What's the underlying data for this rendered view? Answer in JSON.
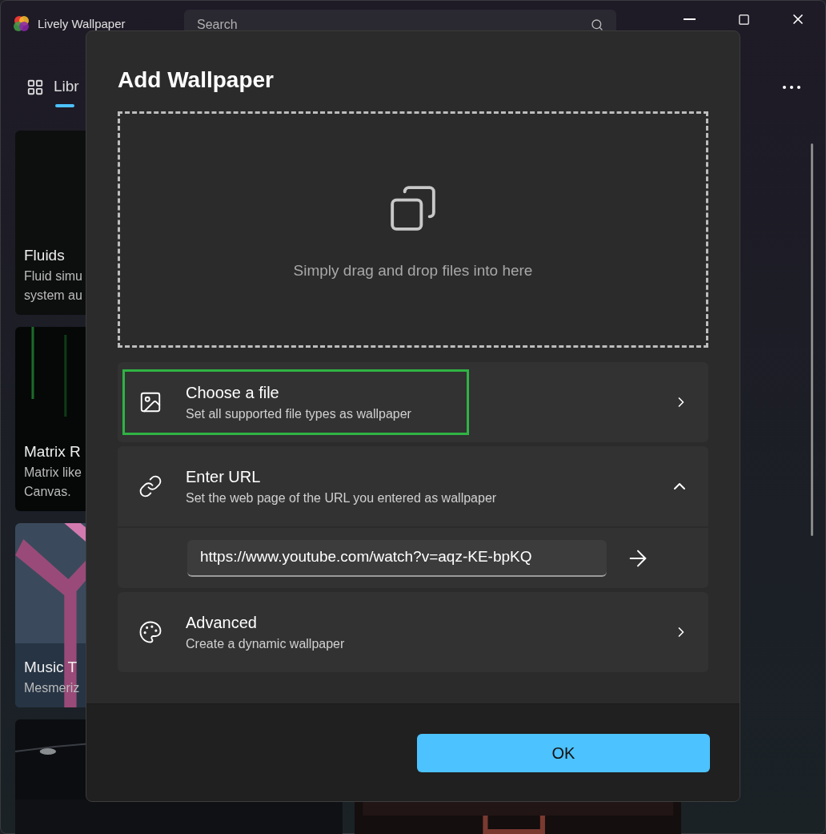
{
  "window": {
    "title": "Lively Wallpaper"
  },
  "search": {
    "placeholder": "Search"
  },
  "nav": {
    "items": [
      {
        "label": "Libr",
        "selected": true
      }
    ]
  },
  "library": {
    "cards": [
      {
        "title": "Fluids",
        "description": [
          "Fluid simu",
          "system au"
        ],
        "kind": "dark"
      },
      {
        "title": "Matrix R",
        "description": [
          "Matrix like",
          "Canvas."
        ],
        "kind": "matrix"
      },
      {
        "title": "Music T",
        "description": [
          "Mesmeriz"
        ],
        "kind": "pink"
      },
      {
        "kind": "night"
      }
    ]
  },
  "dialog": {
    "title": "Add Wallpaper",
    "drop_zone": {
      "text": "Simply drag and drop files into here"
    },
    "options": [
      {
        "kind": "link",
        "title": "Choose a file",
        "subtitle": "Set all supported file types as wallpaper",
        "highlighted": true
      },
      {
        "kind": "expander",
        "title": "Enter URL",
        "subtitle": "Set the web page of the URL you entered as wallpaper",
        "expanded": true,
        "url": "https://www.youtube.com/watch?v=aqz-KE-bpKQ",
        "highlighted": false
      },
      {
        "kind": "link",
        "title": "Advanced",
        "subtitle": "Create a dynamic wallpaper",
        "highlighted": false
      }
    ],
    "ok_button": "OK"
  }
}
